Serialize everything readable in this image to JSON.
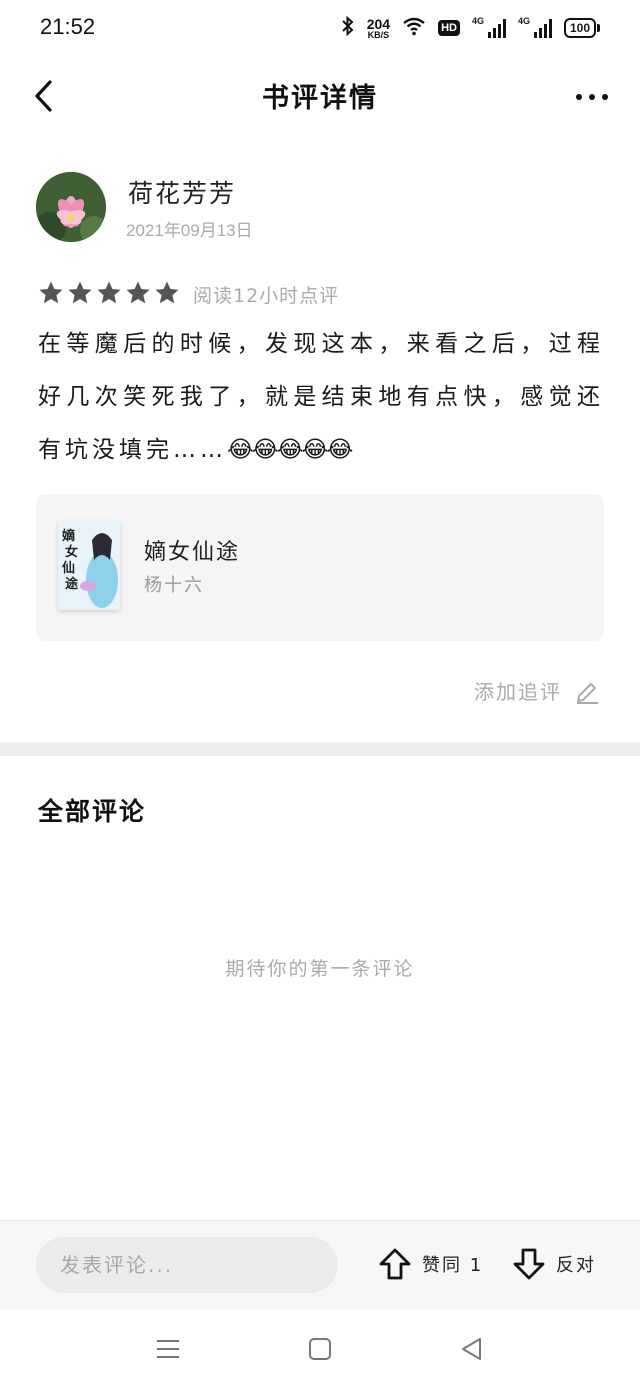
{
  "status_bar": {
    "time": "21:52",
    "net_speed_value": "204",
    "net_speed_unit": "KB/S",
    "hd_label": "HD",
    "sim1_label": "4G",
    "sim2_label": "4G",
    "battery": "100"
  },
  "header": {
    "title": "书评详情",
    "back_icon": "chevron-left-icon",
    "more_icon": "ellipsis-icon"
  },
  "review": {
    "username": "荷花芳芳",
    "date": "2021年09月13日",
    "rating": 5,
    "rating_max": 5,
    "read_time": "阅读12小时点评",
    "text": "在等魔后的时候，发现这本，来看之后，过程好几次笑死我了，就是结束地有点快，感觉还有坑没填完……",
    "emojis": "😂😂😂😂😂"
  },
  "book": {
    "title": "嫡女仙途",
    "author": "杨十六"
  },
  "actions": {
    "add_followup": "添加追评"
  },
  "comments": {
    "heading": "全部评论",
    "empty_hint": "期待你的第一条评论"
  },
  "bottom_bar": {
    "input_placeholder": "发表评论...",
    "agree_label": "赞同 1",
    "oppose_label": "反对"
  },
  "colors": {
    "star": "#555555",
    "muted_text": "#aaaaaa",
    "card_bg": "#f5f5f5"
  }
}
